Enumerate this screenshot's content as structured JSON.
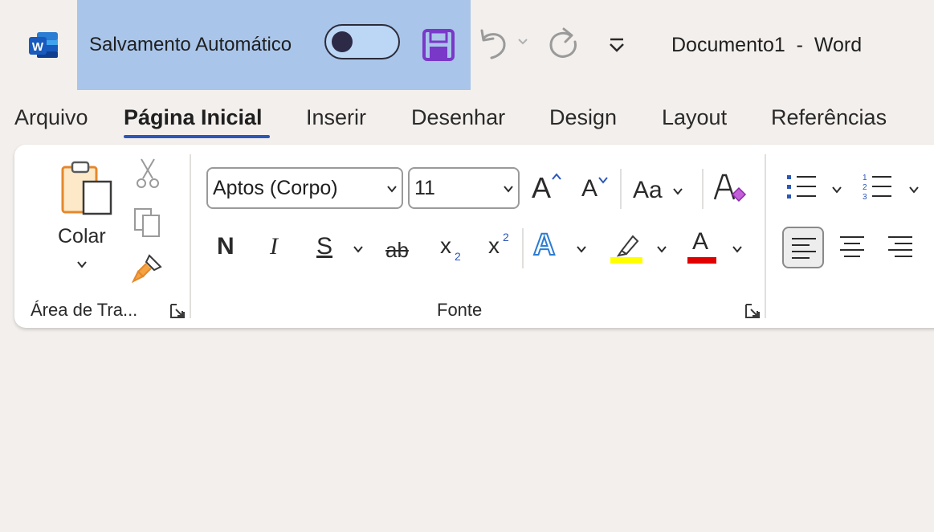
{
  "titlebar": {
    "autosave_label": "Salvamento Automático",
    "autosave_on": false,
    "doc_title": "Documento1  -  Word",
    "app_logo_letter": "W"
  },
  "tabs": [
    {
      "label": "Arquivo",
      "active": false
    },
    {
      "label": "Página Inicial",
      "active": true
    },
    {
      "label": "Inserir",
      "active": false
    },
    {
      "label": "Desenhar",
      "active": false
    },
    {
      "label": "Design",
      "active": false
    },
    {
      "label": "Layout",
      "active": false
    },
    {
      "label": "Referências",
      "active": false
    }
  ],
  "clipboard": {
    "paste_label": "Colar",
    "group_label": "Área de Tra..."
  },
  "font": {
    "font_name": "Aptos (Corpo)",
    "font_size": "11",
    "grow_label": "A",
    "shrink_label": "A",
    "case_label": "Aa",
    "bold_label": "N",
    "italic_label": "I",
    "underline_label": "S",
    "strike_label": "ab",
    "subscript_base": "x",
    "subscript_mark": "2",
    "superscript_base": "x",
    "superscript_mark": "2",
    "effects_label": "A",
    "font_color_label": "A",
    "highlight_color": "#ffff00",
    "font_color": "#e00000",
    "group_label": "Fonte"
  },
  "colors": {
    "accent": "#2b57b8",
    "autosave_bg": "#a9c5ea",
    "save_icon": "#7a38c8",
    "ribbon_bg": "#ffffff",
    "app_bg": "#f3efec"
  }
}
